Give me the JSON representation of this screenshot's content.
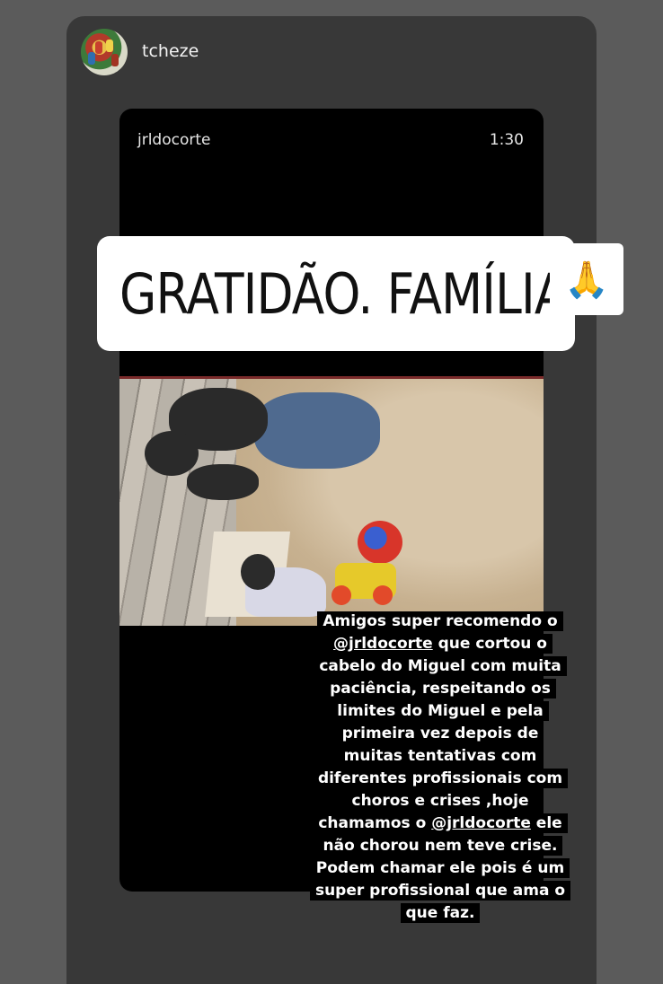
{
  "story": {
    "username": "tcheze"
  },
  "repost": {
    "username": "jrldocorte",
    "time": "1:30"
  },
  "sticker": {
    "text": "GRATIDÃO. FAMÍLIA",
    "emoji": "🙏"
  },
  "caption": {
    "lines": [
      "Amigos super recomendo o",
      "@jrldocorte que cortou o",
      "cabelo do Miguel com muita",
      "paciência, respeitando os",
      "limites do Miguel e pela",
      "primeira vez depois de",
      "muitas tentativas com",
      "diferentes profissionais com",
      "choros e crises ,hoje",
      "chamamos o @jrldocorte ele",
      "não chorou nem teve crise.",
      "Podem chamar ele pois é um",
      "super profissional que ama o",
      "que faz."
    ]
  }
}
